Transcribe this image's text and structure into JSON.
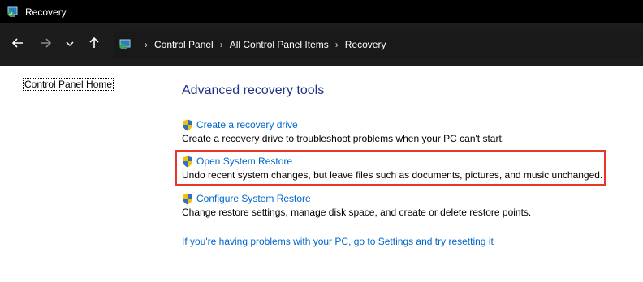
{
  "window": {
    "title": "Recovery",
    "icon": "recovery-app-icon"
  },
  "nav": {
    "back_icon": "arrow-left-icon",
    "forward_icon": "arrow-right-icon",
    "recent_icon": "chevron-down-icon",
    "up_icon": "arrow-up-icon",
    "breadcrumb": [
      "Control Panel",
      "All Control Panel Items",
      "Recovery"
    ]
  },
  "sidebar": {
    "home_label": "Control Panel Home"
  },
  "main": {
    "title": "Advanced recovery tools",
    "tasks": [
      {
        "label": "Create a recovery drive",
        "description": "Create a recovery drive to troubleshoot problems when your PC can't start.",
        "icon": "uac-shield-icon"
      },
      {
        "label": "Open System Restore",
        "description": "Undo recent system changes, but leave files such as documents, pictures, and music unchanged.",
        "icon": "uac-shield-icon"
      },
      {
        "label": "Configure System Restore",
        "description": "Change restore settings, manage disk space, and create or delete restore points.",
        "icon": "uac-shield-icon"
      }
    ],
    "reset_link": "If you're having problems with your PC, go to Settings and try resetting it"
  },
  "colors": {
    "link": "#0066cc",
    "heading": "#1e3287",
    "highlight": "#e8362b",
    "titlebar": "#000000",
    "navbar": "#1c1c1c"
  }
}
